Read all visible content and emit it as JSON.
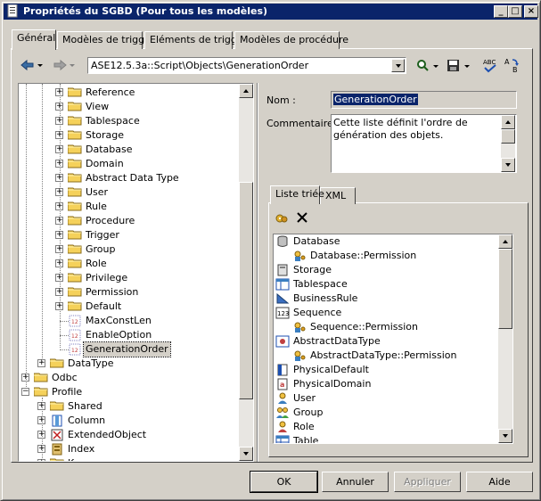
{
  "window": {
    "title": "Propriétés du SGBD (Pour tous les modèles)",
    "controls": {
      "minimize": "_",
      "maximize": "□",
      "close": "×"
    }
  },
  "tabs": [
    {
      "label": "Général"
    },
    {
      "label": "Modèles de trigger"
    },
    {
      "label": "Eléments de trigger"
    },
    {
      "label": "Modèles de procédure"
    }
  ],
  "toolbar": {
    "path": "ASE12.5.3a::Script\\Objects\\GenerationOrder",
    "icons": [
      "back-arrow-icon",
      "forward-arrow-icon",
      "find-icon",
      "save-icon",
      "spell-check-icon",
      "replace-icon"
    ]
  },
  "tree": {
    "items": [
      {
        "label": "Reference",
        "icon": "folder"
      },
      {
        "label": "View",
        "icon": "folder"
      },
      {
        "label": "Tablespace",
        "icon": "folder"
      },
      {
        "label": "Storage",
        "icon": "folder"
      },
      {
        "label": "Database",
        "icon": "folder"
      },
      {
        "label": "Domain",
        "icon": "folder"
      },
      {
        "label": "Abstract Data Type",
        "icon": "folder"
      },
      {
        "label": "User",
        "icon": "folder"
      },
      {
        "label": "Rule",
        "icon": "folder"
      },
      {
        "label": "Procedure",
        "icon": "folder"
      },
      {
        "label": "Trigger",
        "icon": "folder"
      },
      {
        "label": "Group",
        "icon": "folder"
      },
      {
        "label": "Role",
        "icon": "folder"
      },
      {
        "label": "Privilege",
        "icon": "folder"
      },
      {
        "label": "Permission",
        "icon": "folder"
      },
      {
        "label": "Default",
        "icon": "folder"
      },
      {
        "label": "MaxConstLen",
        "icon": "item"
      },
      {
        "label": "EnableOption",
        "icon": "item"
      },
      {
        "label": "GenerationOrder",
        "icon": "item"
      },
      {
        "label": "DataType",
        "icon": "folder"
      },
      {
        "label": "Odbc",
        "icon": "folder"
      },
      {
        "label": "Profile",
        "icon": "folder"
      },
      {
        "label": "Shared",
        "icon": "folder"
      },
      {
        "label": "Column",
        "icon": "column"
      },
      {
        "label": "ExtendedObject",
        "icon": "extended"
      },
      {
        "label": "Index",
        "icon": "index"
      },
      {
        "label": "K...",
        "icon": "folder"
      }
    ]
  },
  "properties": {
    "name_label": "Nom :",
    "name_value": "GenerationOrder",
    "comment_label": "Commentaire :",
    "comment_value": "Cette liste définit l'ordre de génération des objets."
  },
  "subtabs": [
    {
      "label": "Liste triée"
    },
    {
      "label": "XML"
    }
  ],
  "sorted_list": {
    "items": [
      {
        "label": "Database",
        "indent": 0,
        "icon": "database"
      },
      {
        "label": "Database::Permission",
        "indent": 1,
        "icon": "permission"
      },
      {
        "label": "Storage",
        "indent": 0,
        "icon": "storage"
      },
      {
        "label": "Tablespace",
        "indent": 0,
        "icon": "tablespace"
      },
      {
        "label": "BusinessRule",
        "indent": 0,
        "icon": "rule"
      },
      {
        "label": "Sequence",
        "indent": 0,
        "icon": "sequence"
      },
      {
        "label": "Sequence::Permission",
        "indent": 1,
        "icon": "permission"
      },
      {
        "label": "AbstractDataType",
        "indent": 0,
        "icon": "adt"
      },
      {
        "label": "AbstractDataType::Permission",
        "indent": 1,
        "icon": "permission"
      },
      {
        "label": "PhysicalDefault",
        "indent": 0,
        "icon": "default"
      },
      {
        "label": "PhysicalDomain",
        "indent": 0,
        "icon": "domain"
      },
      {
        "label": "User",
        "indent": 0,
        "icon": "user"
      },
      {
        "label": "Group",
        "indent": 0,
        "icon": "group"
      },
      {
        "label": "Role",
        "indent": 0,
        "icon": "role"
      },
      {
        "label": "Table",
        "indent": 0,
        "icon": "table"
      }
    ]
  },
  "buttons": {
    "ok": "OK",
    "cancel": "Annuler",
    "apply": "Appliquer",
    "help": "Aide"
  },
  "colors": {
    "title_bar": "#0a246a",
    "face": "#d4d0c8",
    "folder": "#f5d15a"
  }
}
